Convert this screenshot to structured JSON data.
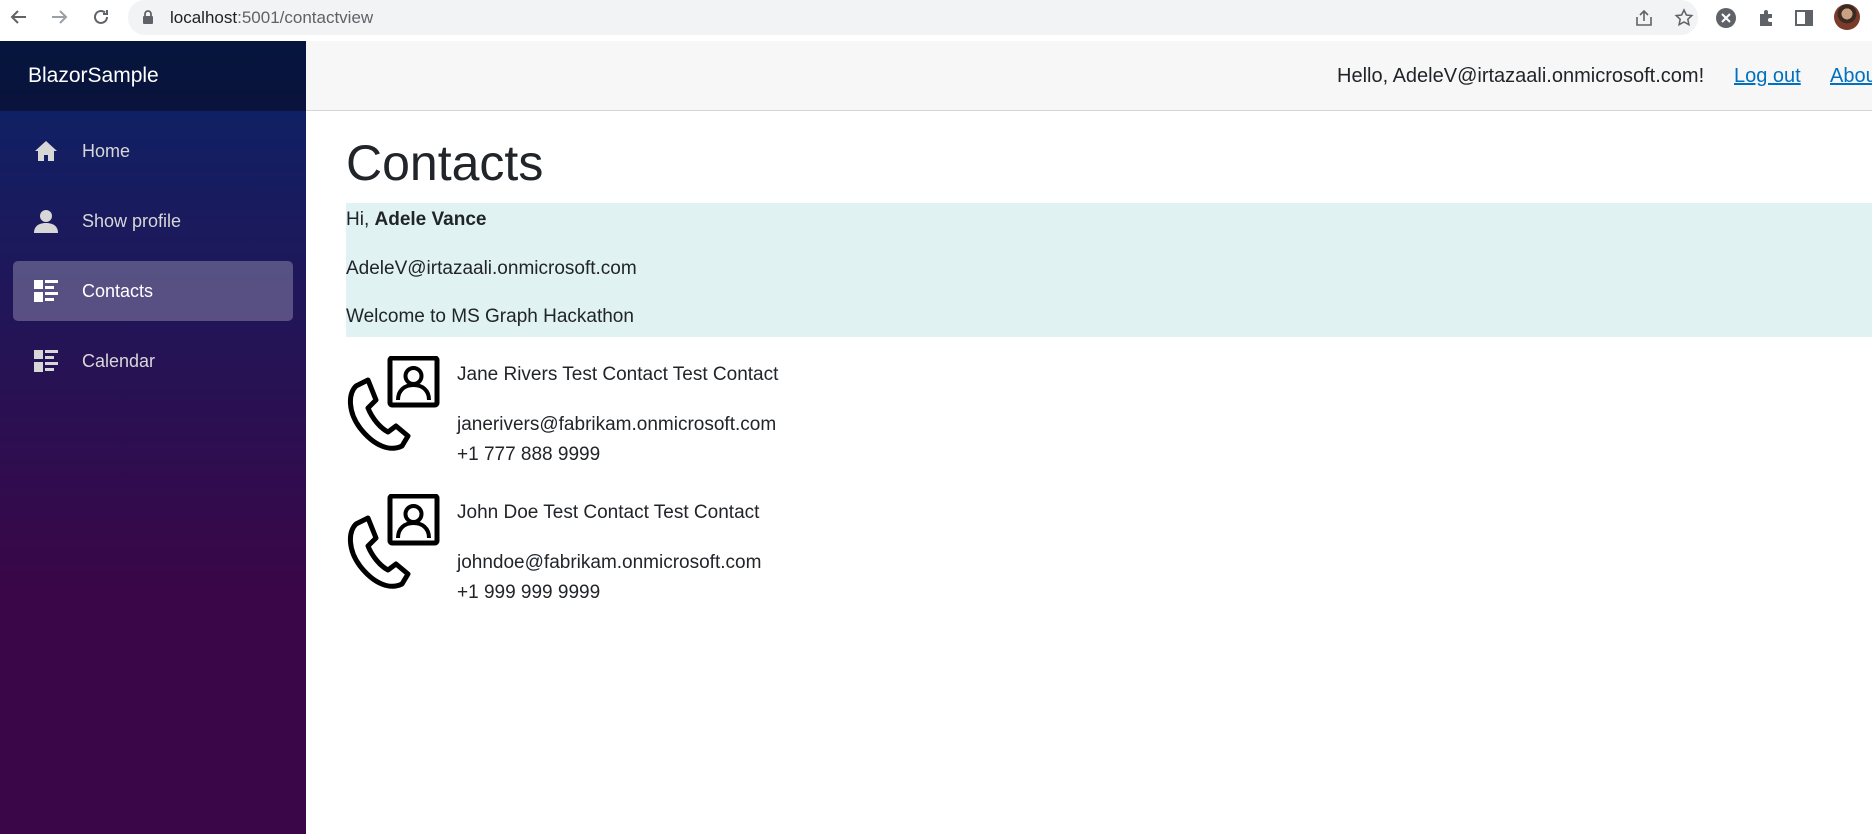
{
  "browser": {
    "url_host": "localhost",
    "url_path": ":5001/contactview"
  },
  "app": {
    "brand": "BlazorSample"
  },
  "sidebar": {
    "items": [
      {
        "label": "Home",
        "icon": "home-icon",
        "active": false
      },
      {
        "label": "Show profile",
        "icon": "person-icon",
        "active": false
      },
      {
        "label": "Contacts",
        "icon": "list-icon",
        "active": true
      },
      {
        "label": "Calendar",
        "icon": "list-icon",
        "active": false
      }
    ]
  },
  "top_row": {
    "greeting": "Hello, AdeleV@irtazaali.onmicrosoft.com!",
    "logout_label": "Log out",
    "about_label": "Abou"
  },
  "main": {
    "title": "Contacts",
    "welcome": {
      "hi_prefix": "Hi, ",
      "name": "Adele Vance",
      "email": "AdeleV@irtazaali.onmicrosoft.com",
      "message": "Welcome to MS Graph Hackathon"
    },
    "contacts": [
      {
        "name": "Jane Rivers Test Contact Test Contact",
        "email": "janerivers@fabrikam.onmicrosoft.com",
        "phone": "+1 777 888 9999"
      },
      {
        "name": "John Doe Test Contact Test Contact",
        "email": "johndoe@fabrikam.onmicrosoft.com",
        "phone": "+1 999 999 9999"
      }
    ]
  },
  "colors": {
    "sidebar_top": "#0a2468",
    "sidebar_bottom": "#3a0647",
    "link": "#0071c1",
    "welcome_bg": "#e0f2f1"
  }
}
